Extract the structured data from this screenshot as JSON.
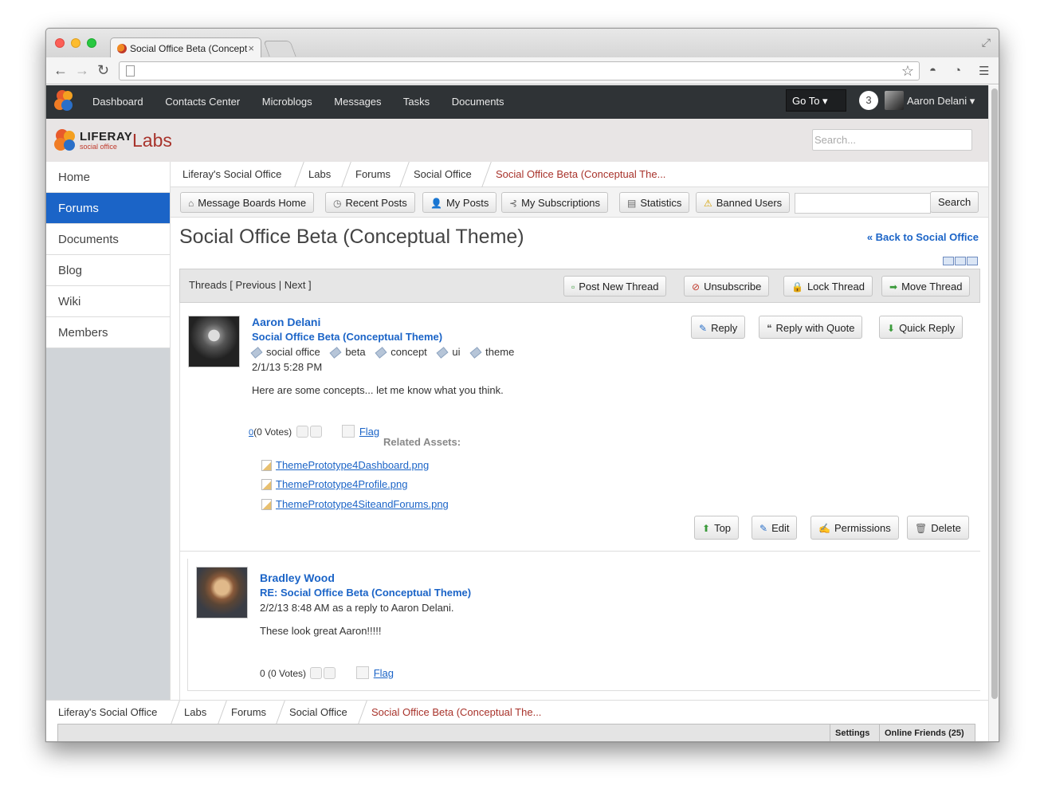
{
  "browser": {
    "tab_title": "Social Office Beta (Concept",
    "tab_close": "×"
  },
  "dock": {
    "nav": [
      "Dashboard",
      "Contacts Center",
      "Microblogs",
      "Messages",
      "Tasks",
      "Documents"
    ],
    "goto": "Go To ▾",
    "notifications": "3",
    "user": "Aaron Delani ▾"
  },
  "site": {
    "brand": "LIFERAY",
    "brand_sub": "social office",
    "name": "Labs",
    "search_placeholder": "Search..."
  },
  "sidebar": {
    "items": [
      "Home",
      "Forums",
      "Documents",
      "Blog",
      "Wiki",
      "Members"
    ],
    "active": "Forums"
  },
  "breadcrumb": [
    "Liferay's Social Office",
    "Labs",
    "Forums",
    "Social Office",
    "Social Office Beta (Conceptual The..."
  ],
  "mb_tabs": {
    "home": "Message Boards Home",
    "recent": "Recent Posts",
    "my_posts": "My Posts",
    "subscriptions": "My Subscriptions",
    "statistics": "Statistics",
    "banned": "Banned Users",
    "search": "Search"
  },
  "thread": {
    "title": "Social Office Beta (Conceptual Theme)",
    "back_link": "« Back to Social Office",
    "nav": "Threads [ Previous | Next ]",
    "actions": {
      "post_new": "Post New Thread",
      "unsubscribe": "Unsubscribe",
      "lock": "Lock Thread",
      "move": "Move Thread"
    }
  },
  "post1": {
    "author": "Aaron Delani",
    "subject": "Social Office Beta (Conceptual Theme)",
    "tags": [
      "social office",
      "beta",
      "concept",
      "ui",
      "theme"
    ],
    "date": "2/1/13 5:28 PM",
    "body": "Here are some concepts... let me know what you think.",
    "votes_score": "0",
    "votes": "(0 Votes)",
    "flag": "Flag",
    "related_label": "Related Assets:",
    "assets": [
      "ThemePrototype4Dashboard.png",
      "ThemePrototype4Profile.png",
      "ThemePrototype4SiteandForums.png"
    ],
    "reply": "Reply",
    "reply_quote": "Reply with Quote",
    "quick_reply": "Quick Reply",
    "top": "Top",
    "edit": "Edit",
    "permissions": "Permissions",
    "delete": "Delete"
  },
  "post2": {
    "author": "Bradley Wood",
    "subject": "RE: Social Office Beta (Conceptual Theme)",
    "date": "2/2/13 8:48 AM as a reply to Aaron Delani.",
    "body": "These look great Aaron!!!!!",
    "votes": "0 (0 Votes)",
    "flag": "Flag"
  },
  "bottom_dock": {
    "settings": "Settings",
    "friends": "Online Friends (25)"
  }
}
